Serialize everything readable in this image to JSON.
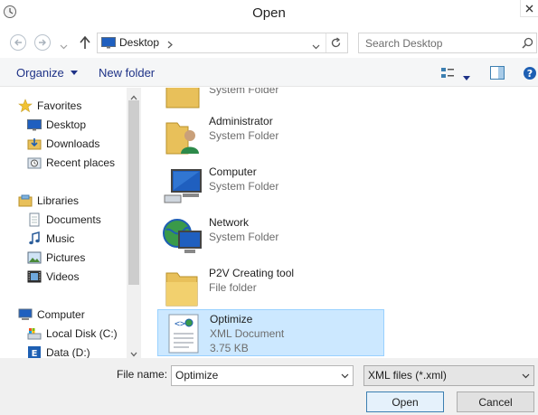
{
  "window": {
    "title": "Open"
  },
  "address": {
    "location": "Desktop"
  },
  "search": {
    "placeholder": "Search Desktop"
  },
  "toolbar": {
    "organize_label": "Organize",
    "new_folder_label": "New folder"
  },
  "navigation": {
    "favorites": {
      "label": "Favorites",
      "items": [
        {
          "label": "Desktop",
          "icon": "desktop-icon"
        },
        {
          "label": "Downloads",
          "icon": "downloads-icon"
        },
        {
          "label": "Recent places",
          "icon": "recent-places-icon"
        }
      ]
    },
    "libraries": {
      "label": "Libraries",
      "items": [
        {
          "label": "Documents",
          "icon": "documents-icon"
        },
        {
          "label": "Music",
          "icon": "music-icon"
        },
        {
          "label": "Pictures",
          "icon": "pictures-icon"
        },
        {
          "label": "Videos",
          "icon": "videos-icon"
        }
      ]
    },
    "computer": {
      "label": "Computer",
      "items": [
        {
          "label": "Local Disk (C:)",
          "icon": "local-disk-icon"
        },
        {
          "label": "Data (D:)",
          "icon": "data-drive-icon"
        }
      ]
    }
  },
  "files": [
    {
      "name": "",
      "type": "System Folder",
      "icon": "system-folder-icon"
    },
    {
      "name": "Administrator",
      "type": "System Folder",
      "icon": "user-folder-icon"
    },
    {
      "name": "Computer",
      "type": "System Folder",
      "icon": "computer-icon"
    },
    {
      "name": "Network",
      "type": "System Folder",
      "icon": "network-icon"
    },
    {
      "name": "P2V Creating tool",
      "type": "File folder",
      "icon": "folder-icon"
    },
    {
      "name": "Optimize",
      "type": "XML Document",
      "size": "3.75 KB",
      "icon": "xml-document-icon",
      "selected": true
    }
  ],
  "bottom": {
    "file_name_label": "File name:",
    "file_name_value": "Optimize",
    "file_type_value": "XML files (*.xml)",
    "open_label": "Open",
    "cancel_label": "Cancel"
  },
  "colors": {
    "accent": "#3c7fb1",
    "selection": "#cce8ff",
    "link_text": "#1e3287"
  }
}
